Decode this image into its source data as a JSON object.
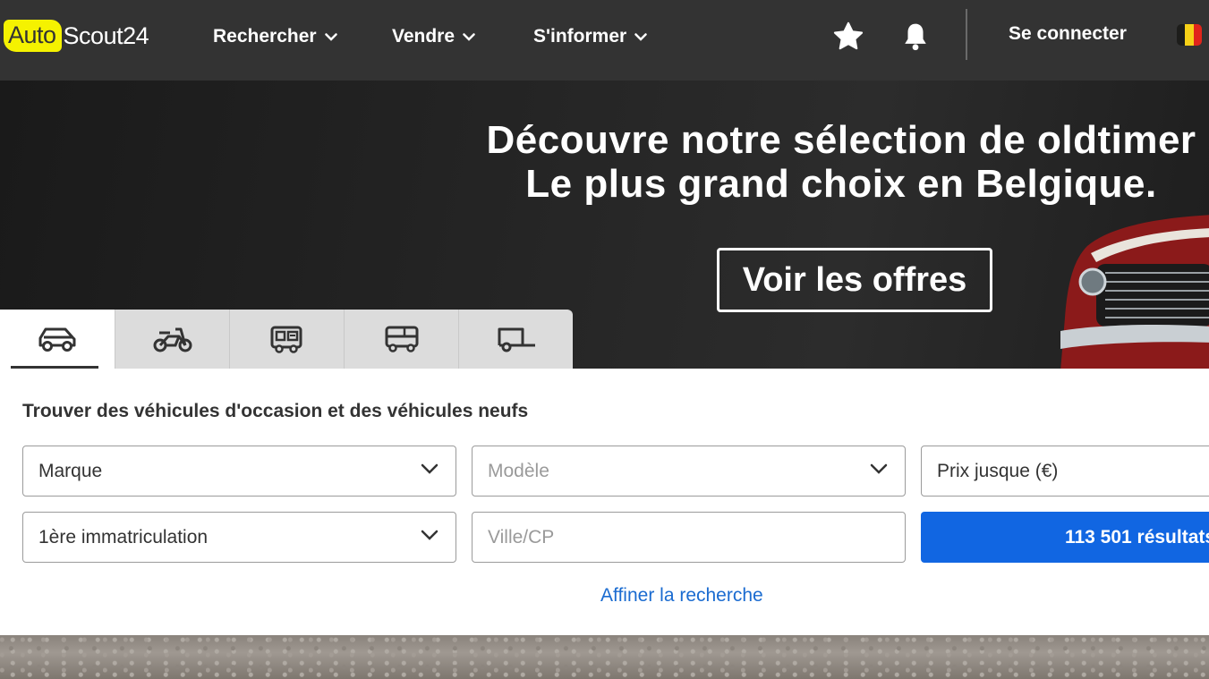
{
  "header": {
    "logo_auto": "Auto",
    "logo_scout": "Scout24",
    "nav": [
      {
        "label": "Rechercher"
      },
      {
        "label": "Vendre"
      },
      {
        "label": "S'informer"
      }
    ],
    "favorites_icon": "star-icon",
    "notifications_icon": "bell-icon",
    "login_label": "Se connecter",
    "flag_colors": [
      "#1d1d1b",
      "#f7d117",
      "#e1251b"
    ]
  },
  "hero": {
    "title_line1": "Découvre notre sélection de oldtimer",
    "title_line2": "Le plus grand choix en Belgique.",
    "cta_label": "Voir les offres"
  },
  "vehicle_tabs": [
    {
      "icon": "car-icon",
      "active": true
    },
    {
      "icon": "motorbike-icon",
      "active": false
    },
    {
      "icon": "camper-icon",
      "active": false
    },
    {
      "icon": "truck-icon",
      "active": false
    },
    {
      "icon": "trailer-icon",
      "active": false
    }
  ],
  "search": {
    "title": "Trouver des véhicules d'occasion et des véhicules neufs",
    "make_value": "Marque",
    "model_placeholder": "Modèle",
    "price_value": "Prix jusque (€)",
    "registration_value": "1ère immatriculation",
    "location_placeholder": "Ville/CP",
    "results_label": "113 501 résultats",
    "refine_label": "Affiner la recherche"
  },
  "colors": {
    "header_bg": "#333333",
    "brand_yellow": "#f5f200",
    "primary_blue": "#1166e2",
    "link_blue": "#1a6bd0"
  }
}
